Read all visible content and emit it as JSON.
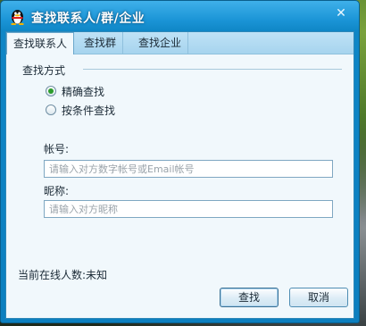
{
  "window": {
    "title": "查找联系人/群/企业",
    "close_glyph": "✕"
  },
  "tabs": [
    {
      "label": "查找联系人",
      "active": true
    },
    {
      "label": "查找群",
      "active": false
    },
    {
      "label": "查找企业",
      "active": false
    }
  ],
  "search_mode": {
    "label": "查找方式",
    "options": [
      {
        "label": "精确查找",
        "selected": true
      },
      {
        "label": "按条件查找",
        "selected": false
      }
    ]
  },
  "fields": {
    "account": {
      "label": "帐号:",
      "placeholder": "请输入对方数字帐号或Email帐号",
      "value": ""
    },
    "nickname": {
      "label": "昵称:",
      "placeholder": "请输入对方昵称",
      "value": ""
    }
  },
  "status": {
    "online_count": "当前在线人数:未知"
  },
  "buttons": {
    "search": "查找",
    "cancel": "取消"
  },
  "colors": {
    "title_bar": "#1a94d6",
    "client_bg": "#f1f8fc",
    "radio_selected": "#2c9c2c"
  }
}
